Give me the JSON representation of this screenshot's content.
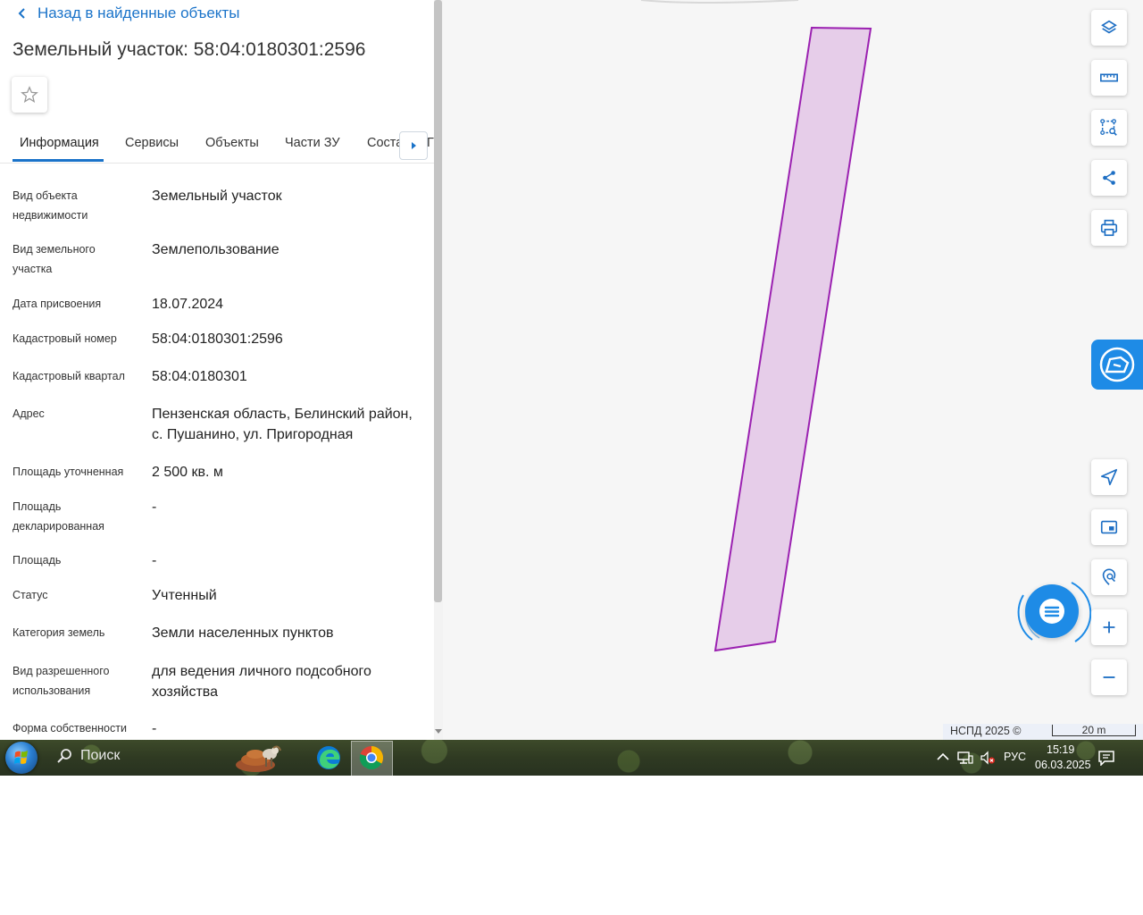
{
  "panel": {
    "back_label": "Назад в найденные объекты",
    "title": "Земельный участок: 58:04:0180301:2596",
    "tabs": [
      "Информация",
      "Сервисы",
      "Объекты",
      "Части ЗУ",
      "Соста",
      "Г"
    ],
    "active_tab": "Информация",
    "rows": [
      {
        "label": "Вид объекта недвижимости",
        "value": "Земельный участок"
      },
      {
        "label": "Вид земельного участка",
        "value": "Землепользование"
      },
      {
        "label": "Дата присвоения",
        "value": "18.07.2024"
      },
      {
        "label": "Кадастровый номер",
        "value": "58:04:0180301:2596"
      },
      {
        "label": "Кадастровый квартал",
        "value": "58:04:0180301"
      },
      {
        "label": "Адрес",
        "value": "Пензенская область, Белинский район, с. Пушанино, ул. Пригородная"
      },
      {
        "label": "Площадь уточненная",
        "value": "2 500 кв. м"
      },
      {
        "label": "Площадь декларированная",
        "value": "-"
      },
      {
        "label": "Площадь",
        "value": "-"
      },
      {
        "label": "Статус",
        "value": "Учтенный"
      },
      {
        "label": "Категория земель",
        "value": "Земли населенных пунктов"
      },
      {
        "label": "Вид разрешенного использования",
        "value": "для ведения личного подсобного хозяйства"
      },
      {
        "label": "Форма собственности",
        "value": "-"
      }
    ]
  },
  "map": {
    "attribution": "НСПД 2025 ©",
    "scale_label": "20 m",
    "parcel_fill": "#e6cde9",
    "parcel_stroke": "#9b21b1",
    "accent": "#1e8be6",
    "tools_top": [
      "layers-icon",
      "ruler-icon",
      "area-select-icon",
      "share-icon",
      "print-icon"
    ],
    "tools_bottom": [
      "navigate-icon",
      "minimap-icon",
      "location-search-icon",
      "zoom-in-icon",
      "zoom-out-icon"
    ]
  },
  "taskbar": {
    "search_label": "Поиск",
    "language": "РУС",
    "time": "15:19",
    "date": "06.03.2025"
  }
}
